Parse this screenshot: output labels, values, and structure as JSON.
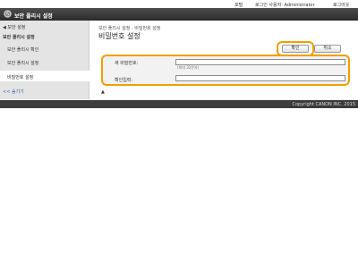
{
  "header": {
    "links": [
      "포털",
      "로그인 사용자: Administrator",
      "로그아웃"
    ],
    "app_title": "보안 폴리시 설정"
  },
  "sidebar": {
    "back_label": "◀ 보안 설정",
    "section_title": "보안 폴리시 설정",
    "items": [
      {
        "label": "보안 폴리시 확인",
        "active": false
      },
      {
        "label": "보안 폴리시 설정",
        "active": false
      },
      {
        "label": "비밀번호 설정",
        "active": true
      }
    ],
    "collapse_label": "<< 숨기기"
  },
  "main": {
    "breadcrumb": "보안 폴리시 설정 : 비밀번호 설정",
    "page_title": "비밀번호 설정",
    "ok_label": "확인",
    "cancel_label": "취소",
    "form": {
      "new_password_label": "새 비밀번호:",
      "new_password_value": "",
      "new_password_hint": "(최대 32문자)",
      "confirm_label": "확인입력:",
      "confirm_value": ""
    },
    "top_icon": "▲"
  },
  "footer": {
    "copyright": "Copyright CANON INC. 2015"
  },
  "colors": {
    "titlebar": "#2b2b2b",
    "sidebar_bg": "#e4e4e4",
    "highlight": "#f0a000"
  }
}
